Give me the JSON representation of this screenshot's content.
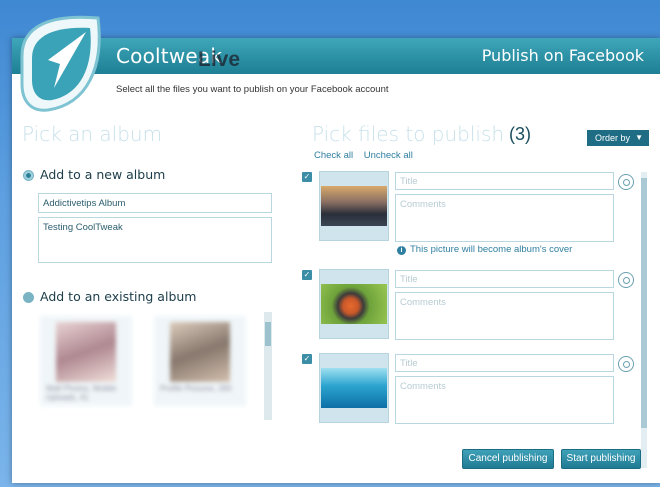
{
  "app": {
    "name": "Cooltweak",
    "live": "Live",
    "header_title": "Publish on Facebook"
  },
  "subtitle": "Select all the files you want to publish on your Facebook account",
  "left": {
    "section_title": "Pick an album",
    "new_album_label": "Add to a new album",
    "album_name_value": "Addictivetips Album",
    "album_description_value": "Testing CoolTweak",
    "existing_album_label": "Add to an existing album",
    "existing_albums": [
      {
        "caption": "Wall Photos, Mobile Uploads, 41"
      },
      {
        "caption": "Profile Pictures, 283"
      }
    ]
  },
  "right": {
    "section_title": "Pick files to publish",
    "count": "(3)",
    "check_all": "Check all",
    "uncheck_all": "Uncheck all",
    "order_by": "Order by",
    "title_placeholder": "Title",
    "comments_placeholder": "Comments",
    "cover_note": "This picture will become album's cover",
    "files": [
      {
        "checked": true,
        "photo": "sunset-rocks"
      },
      {
        "checked": true,
        "photo": "bird"
      },
      {
        "checked": true,
        "photo": "underwater"
      }
    ]
  },
  "buttons": {
    "cancel": "Cancel publishing",
    "start": "Start publishing"
  },
  "colors": {
    "accent": "#1f7b93",
    "section_title": "#c8e1ea",
    "link": "#2f7fa1",
    "background": "#5d9fe0"
  }
}
